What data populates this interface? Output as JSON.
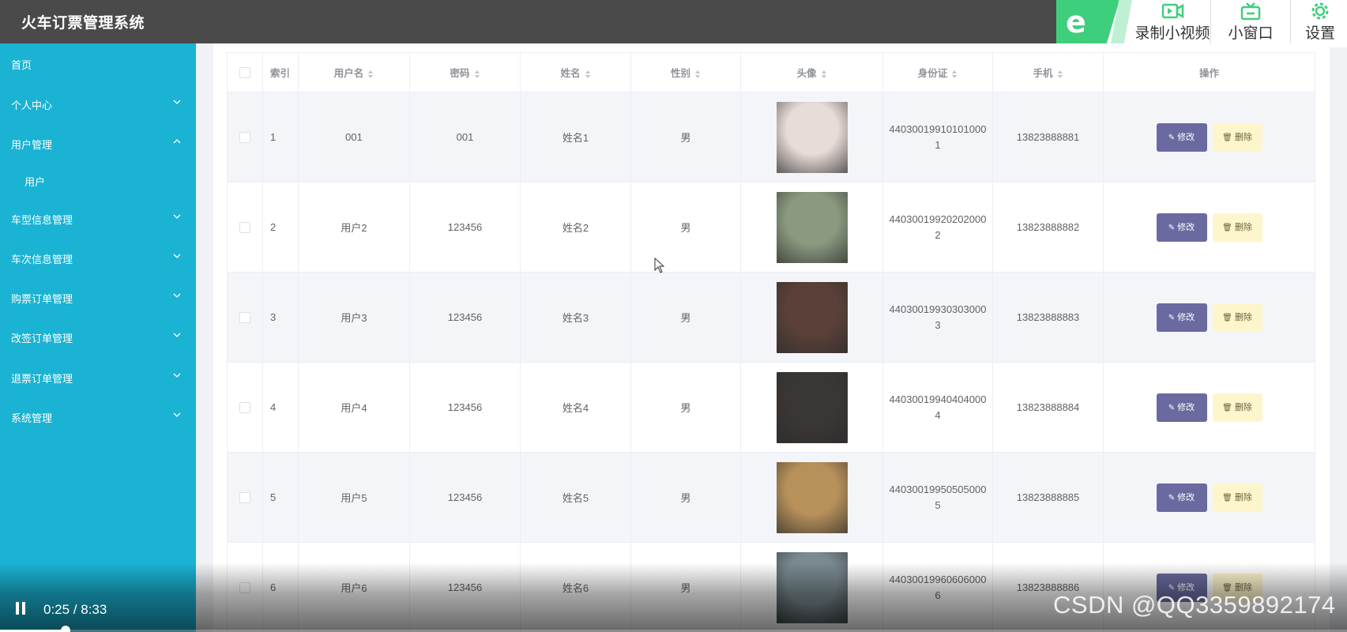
{
  "header": {
    "title": "火车订票管理系统"
  },
  "recorder": {
    "logo_glyph": "e",
    "record_label": "录制小视频",
    "miniwindow_label": "小窗口",
    "settings_label": "设置"
  },
  "sidebar": {
    "items": [
      {
        "label": "首页",
        "chevron": "none"
      },
      {
        "label": "个人中心",
        "chevron": "down"
      },
      {
        "label": "用户管理",
        "chevron": "up"
      },
      {
        "label": "用户",
        "chevron": "none"
      },
      {
        "label": "车型信息管理",
        "chevron": "down"
      },
      {
        "label": "车次信息管理",
        "chevron": "down"
      },
      {
        "label": "购票订单管理",
        "chevron": "down"
      },
      {
        "label": "改签订单管理",
        "chevron": "down"
      },
      {
        "label": "退票订单管理",
        "chevron": "down"
      },
      {
        "label": "系统管理",
        "chevron": "down"
      }
    ]
  },
  "table": {
    "columns": [
      "",
      "索引",
      "用户名",
      "密码",
      "姓名",
      "性别",
      "头像",
      "身份证",
      "手机",
      "操作"
    ],
    "edit_label": "修改",
    "delete_label": "删除",
    "rows": [
      {
        "index": "1",
        "username": "001",
        "password": "001",
        "name": "姓名1",
        "gender": "男",
        "id_card": "440300199101010001",
        "phone": "13823888881",
        "avatar_color": "#e8dcd8"
      },
      {
        "index": "2",
        "username": "用户2",
        "password": "123456",
        "name": "姓名2",
        "gender": "男",
        "id_card": "440300199202020002",
        "phone": "13823888882",
        "avatar_color": "#8a9a80"
      },
      {
        "index": "3",
        "username": "用户3",
        "password": "123456",
        "name": "姓名3",
        "gender": "男",
        "id_card": "440300199303030003",
        "phone": "13823888883",
        "avatar_color": "#5a4038"
      },
      {
        "index": "4",
        "username": "用户4",
        "password": "123456",
        "name": "姓名4",
        "gender": "男",
        "id_card": "440300199404040004",
        "phone": "13823888884",
        "avatar_color": "#3a3634"
      },
      {
        "index": "5",
        "username": "用户5",
        "password": "123456",
        "name": "姓名5",
        "gender": "男",
        "id_card": "440300199505050005",
        "phone": "13823888885",
        "avatar_color": "#b8905a"
      },
      {
        "index": "6",
        "username": "用户6",
        "password": "123456",
        "name": "姓名6",
        "gender": "男",
        "id_card": "440300199606060006",
        "phone": "13823888886",
        "avatar_color": "#7a8a90"
      }
    ]
  },
  "video": {
    "current_time": "0:25",
    "total_time": "8:33",
    "time_display": "0:25 / 8:33",
    "progress_fraction": 0.0487,
    "watermark": "CSDN @QQ3359892174"
  }
}
